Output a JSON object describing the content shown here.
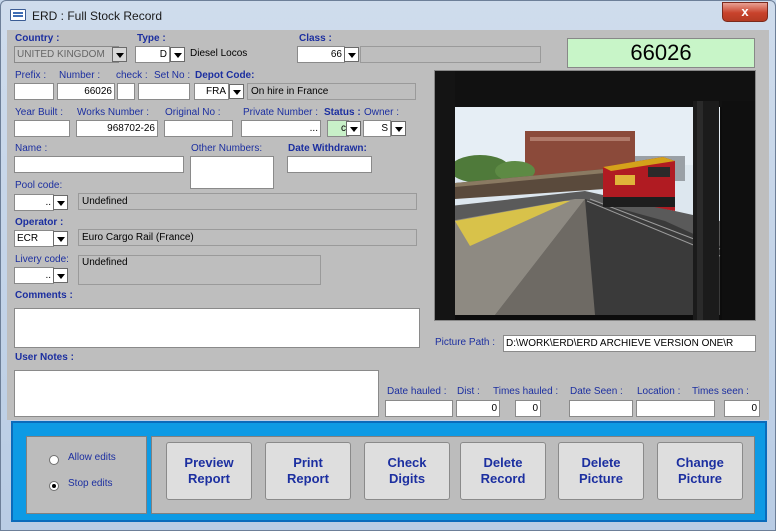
{
  "window": {
    "title": "ERD : Full Stock Record",
    "close_glyph": "x"
  },
  "labels": {
    "country": "Country :",
    "type": "Type :",
    "class": "Class :",
    "prefix": "Prefix :",
    "number": "Number :",
    "check": "check :",
    "set_no": "Set No :",
    "depot_code": "Depot Code:",
    "year_built": "Year Built :",
    "works_number": "Works Number :",
    "original_no": "Original No :",
    "private_number": "Private Number :",
    "status": "Status :",
    "owner": "Owner :",
    "name": "Name :",
    "other_numbers": "Other Numbers:",
    "date_withdrawn": "Date Withdrawn:",
    "pool_code": "Pool code:",
    "operator": "Operator :",
    "livery_code": "Livery code:",
    "comments": "Comments :",
    "user_notes": "User Notes :",
    "picture_path": "Picture Path :",
    "date_hauled": "Date hauled :",
    "dist": "Dist :",
    "times_hauled": "Times hauled :",
    "date_seen": "Date Seen :",
    "location": "Location :",
    "times_seen": "Times seen :"
  },
  "fields": {
    "country": "UNITED KINGDOM",
    "type_code": "D",
    "type_desc": "Diesel Locos",
    "class": "66",
    "big_number": "66026",
    "prefix": "",
    "number": "66026",
    "check": "",
    "set_no": "",
    "depot_code": "FRA",
    "depot_desc": "On hire in France",
    "year_built": "",
    "works_number": "968702-26",
    "original_no": "",
    "private_number": "...",
    "status": "c",
    "owner": "S",
    "name": "",
    "other_numbers": "",
    "date_withdrawn": "",
    "pool_code": "..",
    "pool_desc": "Undefined",
    "operator": "ECR",
    "operator_desc": "Euro Cargo Rail (France)",
    "livery_code": "..",
    "livery_desc": "Undefined",
    "comments": "",
    "user_notes": "",
    "picture_path": "D:\\WORK\\ERD\\ERD ARCHIEVE VERSION ONE\\R",
    "date_hauled": "",
    "dist": "0",
    "times_hauled": "0",
    "date_seen": "",
    "location": "",
    "times_seen": "0"
  },
  "edit_mode": {
    "allow": "Allow edits",
    "stop": "Stop edits",
    "selected": "stop"
  },
  "buttons": {
    "preview": "Preview Report",
    "print": "Print Report",
    "check": "Check Digits",
    "delete_record": "Delete Record",
    "delete_picture": "Delete Picture",
    "change_picture": "Change Picture"
  },
  "photo": {
    "loco_livery": "#b01b22",
    "loco_roof": "#d4a21a"
  }
}
